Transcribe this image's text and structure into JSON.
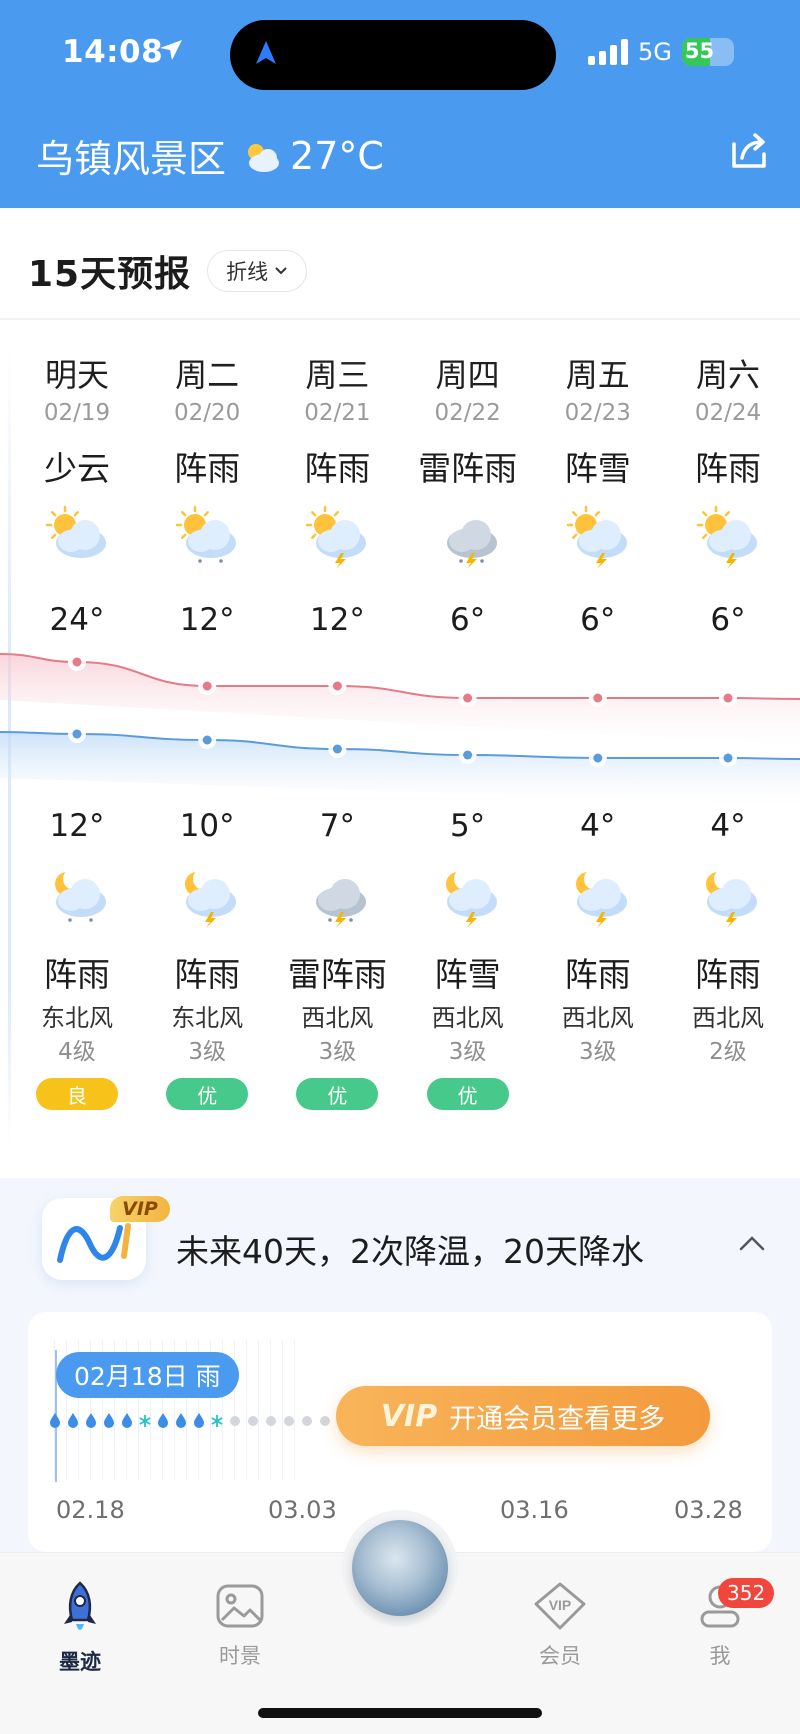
{
  "status_bar": {
    "time": "14:08",
    "network": "5G",
    "battery": "55",
    "battery_level": 0.55
  },
  "header": {
    "title": "乌镇风景区",
    "temperature": "27°C",
    "weather_icon": "partly-cloudy-icon",
    "share_icon": "share-icon"
  },
  "forecast": {
    "title": "15天预报",
    "view_chip": "折线",
    "days": [
      {
        "name": "明天",
        "date": "02/19",
        "day_cond": "少云",
        "day_icon": "sun-cloud",
        "high": "24°",
        "low": "12°",
        "night_icon": "moon-cloud-rain",
        "night_cond": "阵雨",
        "wind": "东北风",
        "wind_level": "4级",
        "aqi": "良",
        "aqi_color": "#f7c21a"
      },
      {
        "name": "周二",
        "date": "02/20",
        "day_cond": "阵雨",
        "day_icon": "sun-cloud-rain",
        "high": "12°",
        "low": "10°",
        "night_icon": "moon-cloud-thunder",
        "night_cond": "阵雨",
        "wind": "东北风",
        "wind_level": "3级",
        "aqi": "优",
        "aqi_color": "#46c98a"
      },
      {
        "name": "周三",
        "date": "02/21",
        "day_cond": "阵雨",
        "day_icon": "sun-cloud-thunder",
        "high": "12°",
        "low": "7°",
        "night_icon": "cloud-thunder-rain",
        "night_cond": "雷阵雨",
        "wind": "西北风",
        "wind_level": "3级",
        "aqi": "优",
        "aqi_color": "#46c98a"
      },
      {
        "name": "周四",
        "date": "02/22",
        "day_cond": "雷阵雨",
        "day_icon": "cloud-thunder-rain",
        "high": "6°",
        "low": "5°",
        "night_icon": "moon-cloud-thunder",
        "night_cond": "阵雪",
        "wind": "西北风",
        "wind_level": "3级",
        "aqi": "优",
        "aqi_color": "#46c98a"
      },
      {
        "name": "周五",
        "date": "02/23",
        "day_cond": "阵雪",
        "day_icon": "sun-cloud-thunder",
        "high": "6°",
        "low": "4°",
        "night_icon": "moon-cloud-thunder",
        "night_cond": "阵雨",
        "wind": "西北风",
        "wind_level": "3级",
        "aqi": "",
        "aqi_color": ""
      },
      {
        "name": "周六",
        "date": "02/24",
        "day_cond": "阵雨",
        "day_icon": "sun-cloud-thunder",
        "high": "6°",
        "low": "4°",
        "night_icon": "moon-cloud-thunder",
        "night_cond": "阵雨",
        "wind": "西北风",
        "wind_level": "2级",
        "aqi": "",
        "aqi_color": ""
      }
    ]
  },
  "chart_data": {
    "type": "line",
    "categories": [
      "02/19",
      "02/20",
      "02/21",
      "02/22",
      "02/23",
      "02/24"
    ],
    "series": [
      {
        "values": [
          24,
          12,
          12,
          6,
          6,
          6
        ],
        "color": "#e57b8a"
      },
      {
        "values": [
          12,
          10,
          7,
          5,
          4,
          4
        ],
        "color": "#5b9bdc"
      }
    ]
  },
  "vip": {
    "badge": "VIP",
    "summary": "未来40天，2次降温，20天降水",
    "date_pill": "02月18日 雨",
    "button_badge": "VIP",
    "button_label": "开通会员查看更多",
    "axis_dates": [
      "02.18",
      "03.03",
      "03.16",
      "03.28"
    ],
    "precip_marks": [
      "rain",
      "rain",
      "rain",
      "rain",
      "rain",
      "snow",
      "rain",
      "rain",
      "rain",
      "snow",
      "none",
      "none",
      "none",
      "none",
      "none",
      "none"
    ]
  },
  "nav": {
    "items": [
      {
        "label": "墨迹",
        "icon": "rocket-icon",
        "active": true
      },
      {
        "label": "时景",
        "icon": "photo-icon",
        "active": false
      },
      {
        "label": "会员",
        "icon": "vip-diamond-icon",
        "active": false
      },
      {
        "label": "我",
        "icon": "profile-icon",
        "active": false
      }
    ],
    "badge_count": "352"
  }
}
